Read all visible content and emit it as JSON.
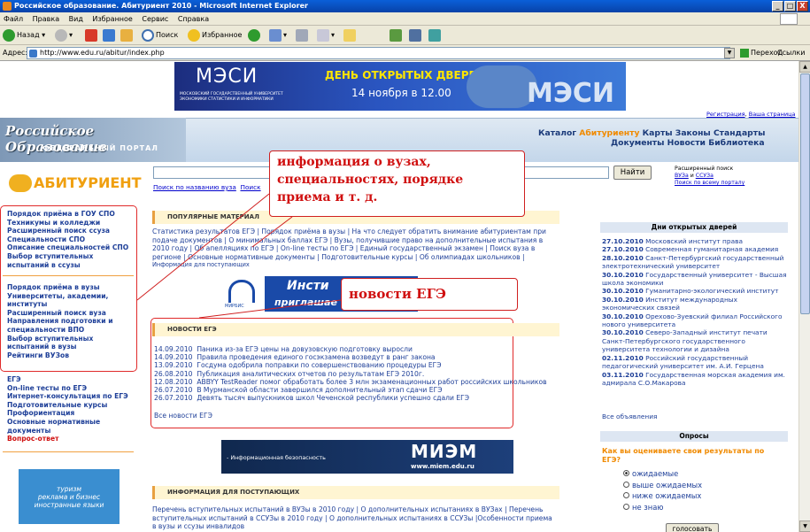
{
  "window": {
    "title": "Российское образование. Абитуриент 2010 - Microsoft Internet Explorer",
    "minimize": "_",
    "maximize": "□",
    "close": "X"
  },
  "menu": [
    "Файл",
    "Правка",
    "Вид",
    "Избранное",
    "Сервис",
    "Справка"
  ],
  "toolbar": {
    "back": "Назад",
    "search": "Поиск",
    "favorites": "Избранное"
  },
  "address": {
    "label": "Адрес:",
    "url": "http://www.edu.ru/abitur/index.php",
    "go": "Переход",
    "links": "Ссылки"
  },
  "banner_top": {
    "brand": "МЭСИ",
    "brand_sub": "МОСКОВСКИЙ ГОСУДАРСТВЕННЫЙ УНИВЕРСИТЕТ ЭКОНОМИКИ СТАТИСТИКИ И ИНФОРМАТИКИ",
    "headline": "ДЕНЬ ОТКРЫТЫХ ДВЕРЕЙ",
    "date": "14 ноября в 12.00",
    "brand2": "МЭСИ"
  },
  "top_links": {
    "register": "Регистрация",
    "home": "Ваша страница"
  },
  "portal": {
    "title": "Российское Образование",
    "subtitle": "ФЕДЕРАЛЬНЫЙ ПОРТАЛ"
  },
  "nav": {
    "catalog": "Каталог",
    "abit": "Абитуриенту",
    "maps": "Карты",
    "laws": "Законы",
    "standards": "Стандарты",
    "docs": "Документы",
    "news": "Новости",
    "library": "Библиотека"
  },
  "abit_logo": "АБИТУРИЕНТ",
  "search": {
    "button": "Найти",
    "by_name": "Поиск по названию вуза",
    "by_name2": "Поиск",
    "adv1": "Расширенный поиск",
    "adv2": "ВУЗа",
    "adv_and": "и",
    "adv3": "ССУЗа",
    "adv4": "Поиск по всему порталу"
  },
  "left_group1": [
    "Порядок приёма в ГОУ СПО",
    "Техникумы и колледжи",
    "Расширенный поиск ссуза",
    "Специальности СПО",
    "Описание специальностей СПО",
    "Выбор вступительных",
    "испытаний в ссузы"
  ],
  "left_group2": [
    "Порядок приёма в вузы",
    "Университеты, академии,",
    "институты",
    "Расширенный поиск вуза",
    "Направления подготовки и",
    "специальности ВПО",
    "Выбор вступительных",
    "испытаний в вузы",
    "Рейтинги ВУЗов"
  ],
  "left_group3": [
    "ЕГЭ",
    "On-line тесты по ЕГЭ",
    "Интернет-консультация по ЕГЭ",
    "Подготовительные курсы",
    "Профориентация",
    "Основные нормативные",
    "документы"
  ],
  "left_red": "Вопрос-ответ",
  "left_ad": [
    "туризм",
    "реклама и бизнес",
    "иностранные языки"
  ],
  "popular": {
    "title": "ПОПУЛЯРНЫЕ МАТЕРИАЛ",
    "lines": [
      "Статистика результатов ЕГЭ  |  Порядок приёма в вузы  |  На что следует обратить внимание абитуриентам при",
      "подаче документов  |  О минимальных баллах ЕГЭ  |  Вузы, получившие право на дополнительные испытания в",
      "2010 году  |  Об апелляциях по ЕГЭ  |  On-line тесты по ЕГЭ  |  Единый государственный экзамен  |  Поиск вуза в",
      "регионе  |  Основные нормативные документы  |  Подготовительные курсы  |  Об олимпиадах школьников  |"
    ],
    "last": "Информация для поступающих"
  },
  "callout1": [
    "информация о вузах,",
    "специальностях, порядке",
    "приема и т. д."
  ],
  "callout2": "новости ЕГЭ",
  "banner_mid": {
    "line1": "Инсти",
    "line2": "приглашае",
    "brand": "МИРБИС"
  },
  "ege_news": {
    "title": "НОВОСТИ ЕГЭ",
    "items": [
      [
        "14.09.2010",
        "Паникa из-за ЕГЭ цены на довузовскую подготовку выросли"
      ],
      [
        "14.09.2010",
        "Правила проведения единого госэкзамена возведут в ранг закона"
      ],
      [
        "13.09.2010",
        "Госдума одобрила поправки по совершенствованию процедуры ЕГЭ"
      ],
      [
        "26.08.2010",
        "Публикация аналитических отчетов по результатам ЕГЭ 2010г."
      ],
      [
        "12.08.2010",
        "ABBYY TestReader помог обработать более 3 млн экзаменационных работ российских школьников"
      ],
      [
        "26.07.2010",
        "В Мурманской области завершился дополнительный этап сдачи ЕГЭ"
      ],
      [
        "26.07.2010",
        "Девять тысяч выпускников школ Чеченской республики успешно сдали ЕГЭ"
      ]
    ],
    "all": "Все новости ЕГЭ"
  },
  "banner_miem": {
    "lines": [
      "- Информационная безопасность",
      "- Электронная техника, радиотехника",
      "  и связь",
      "- Автоматика и управление"
    ],
    "brand": "МИЭМ",
    "url": "www.miem.edu.ru"
  },
  "info": {
    "title": "ИНФОРМАЦИЯ ДЛЯ ПОСТУПАЮЩИХ",
    "lines": [
      "Перечень вступительных испытаний в ВУЗы в 2010 году  |  О дополнительных испытаниях в ВУЗах  |  Перечень",
      "вступительных испытаний в ССУЗы в 2010 году  |  О дополнительных испытаниях в ССУЗы  |Особенности приема",
      "в вузы и ссузы инвалидов"
    ]
  },
  "open_days": {
    "title": "Дни открытых дверей",
    "items": [
      [
        "27.10.2010",
        "Московский институт права"
      ],
      [
        "27.10.2010",
        "Современная гуманитарная академия"
      ],
      [
        "28.10.2010",
        "Санкт-Петербургский государственный электротехнический университет"
      ],
      [
        "30.10.2010",
        "Государственный университет - Высшая школа экономики"
      ],
      [
        "30.10.2010",
        "Гуманитарно-экологический институт"
      ],
      [
        "30.10.2010",
        "Институт международных экономических связей"
      ],
      [
        "30.10.2010",
        "Орехово-Зуевский филиал Российского нового университета"
      ],
      [
        "30.10.2010",
        "Северо-Западный институт печати Санкт-Петербургского государственного университета технологии и дизайна"
      ],
      [
        "02.11.2010",
        "Российский государственный педагогический университет им. А.И. Герцена"
      ],
      [
        "03.11.2010",
        "Государственная морская академия им. адмирала С.О.Макарова"
      ]
    ],
    "all": "Все объявления"
  },
  "poll": {
    "title": "Опросы",
    "question": "Как вы оцениваете свои результаты по ЕГЭ?",
    "options": [
      "ожидаемые",
      "выше ожидаемых",
      "ниже ожидаемых",
      "не знаю"
    ],
    "vote": "голосовать"
  }
}
